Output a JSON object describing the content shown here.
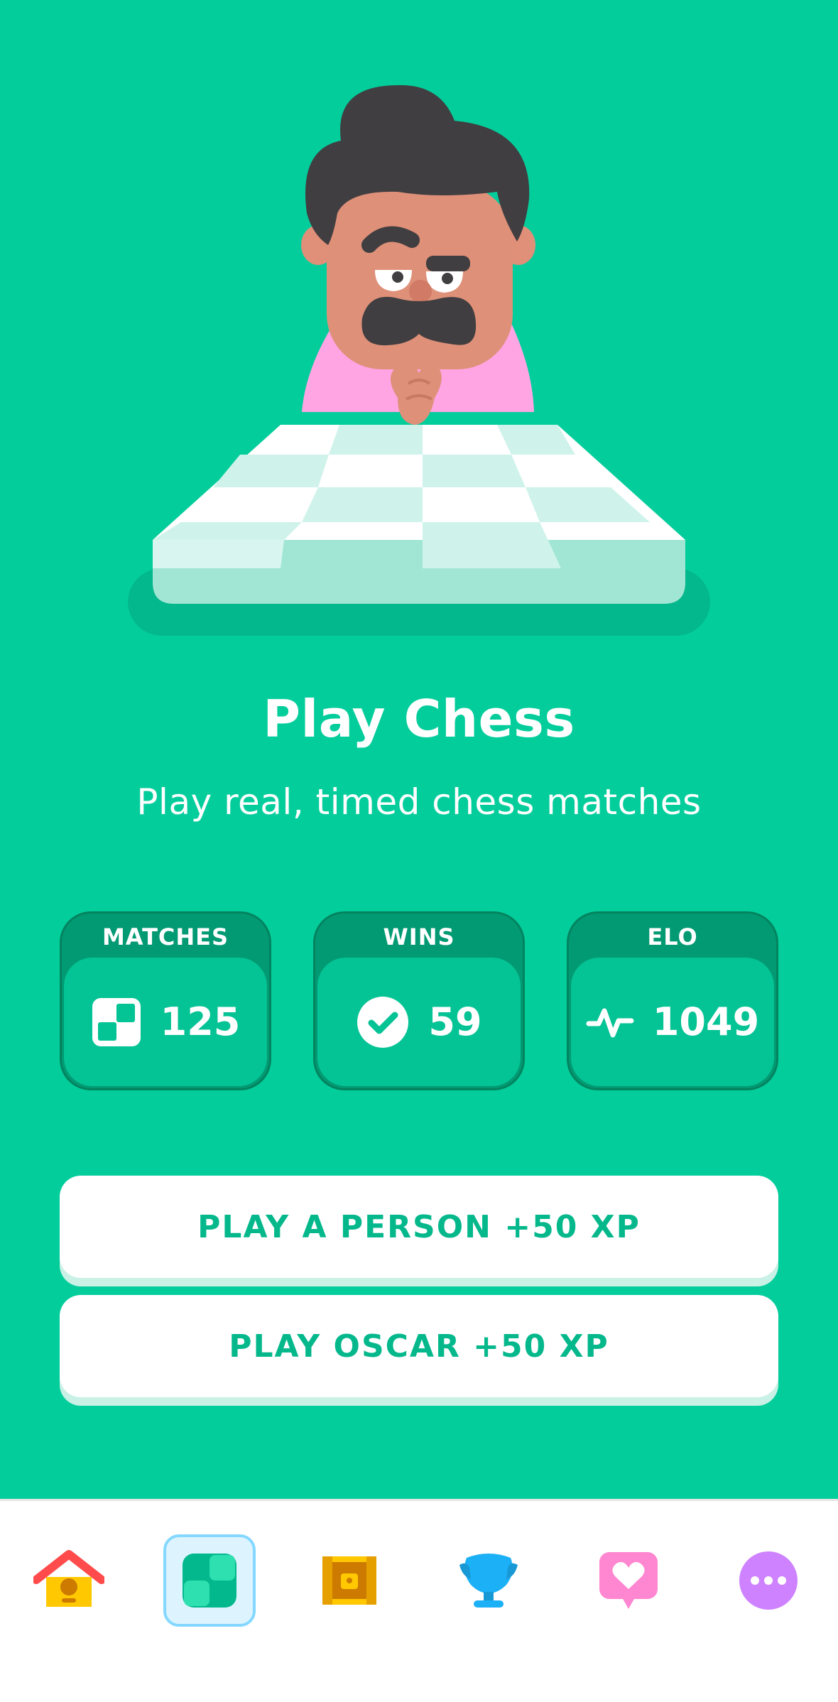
{
  "hero": {
    "title": "Play Chess",
    "subtitle": "Play real, timed chess matches"
  },
  "stats": [
    {
      "label": "MATCHES",
      "value": "125",
      "icon": "chessboard-icon"
    },
    {
      "label": "WINS",
      "value": "59",
      "icon": "checkmark-icon"
    },
    {
      "label": "ELO",
      "value": "1049",
      "icon": "pulse-icon"
    }
  ],
  "actions": {
    "play_person": "PLAY A PERSON +50 XP",
    "play_oscar": "PLAY OSCAR +50 XP"
  },
  "tabbar": {
    "items": [
      {
        "icon": "home-icon",
        "active": false
      },
      {
        "icon": "chess-icon",
        "active": true
      },
      {
        "icon": "treasure-chest-icon",
        "active": false
      },
      {
        "icon": "trophy-icon",
        "active": false
      },
      {
        "icon": "heart-message-icon",
        "active": false
      },
      {
        "icon": "more-icon",
        "active": false
      }
    ]
  },
  "colors": {
    "background": "#04cd9c",
    "button_text": "#04b88c",
    "tab_active": "#ddf4ff",
    "tab_active_border": "#84d8ff"
  }
}
